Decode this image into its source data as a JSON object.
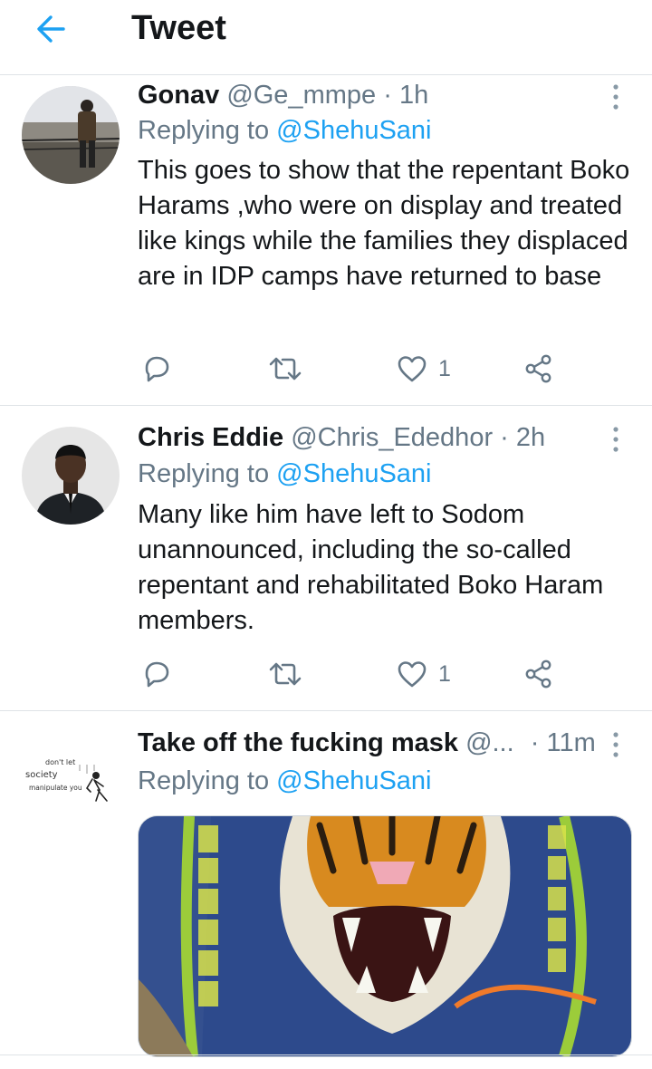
{
  "header": {
    "title": "Tweet"
  },
  "tweets": [
    {
      "name": "Gonav",
      "handle": "@Ge_mmpe",
      "dot": "·",
      "time": "1h",
      "replying_prefix": "Replying to",
      "replying_to": "@ShehuSani",
      "text": "This goes to show that the repentant Boko Harams ,who were on display and treated like kings while the families they displaced are in IDP camps have returned to base",
      "likes": "1"
    },
    {
      "name": "Chris Eddie",
      "handle": "@Chris_Ededhor",
      "dot": "·",
      "time": "2h",
      "replying_prefix": "Replying to",
      "replying_to": "@ShehuSani",
      "text": "Many like him have left to Sodom unannounced, including the so-called repentant and rehabilitated Boko Haram members.",
      "likes": "1"
    },
    {
      "name": "Take off the fucking mask",
      "handle": "@...",
      "dot": "·",
      "time": "11m",
      "replying_prefix": "Replying to",
      "replying_to": "@ShehuSani",
      "avatar_text": [
        "don't let",
        "society",
        "manipulate you"
      ]
    }
  ],
  "colors": {
    "accent": "#1da1f2",
    "secondary_text": "#657786",
    "primary_text": "#14171a"
  },
  "icons": [
    "back-arrow-icon",
    "more-vertical-icon",
    "reply-icon",
    "retweet-icon",
    "heart-icon",
    "share-icon"
  ]
}
